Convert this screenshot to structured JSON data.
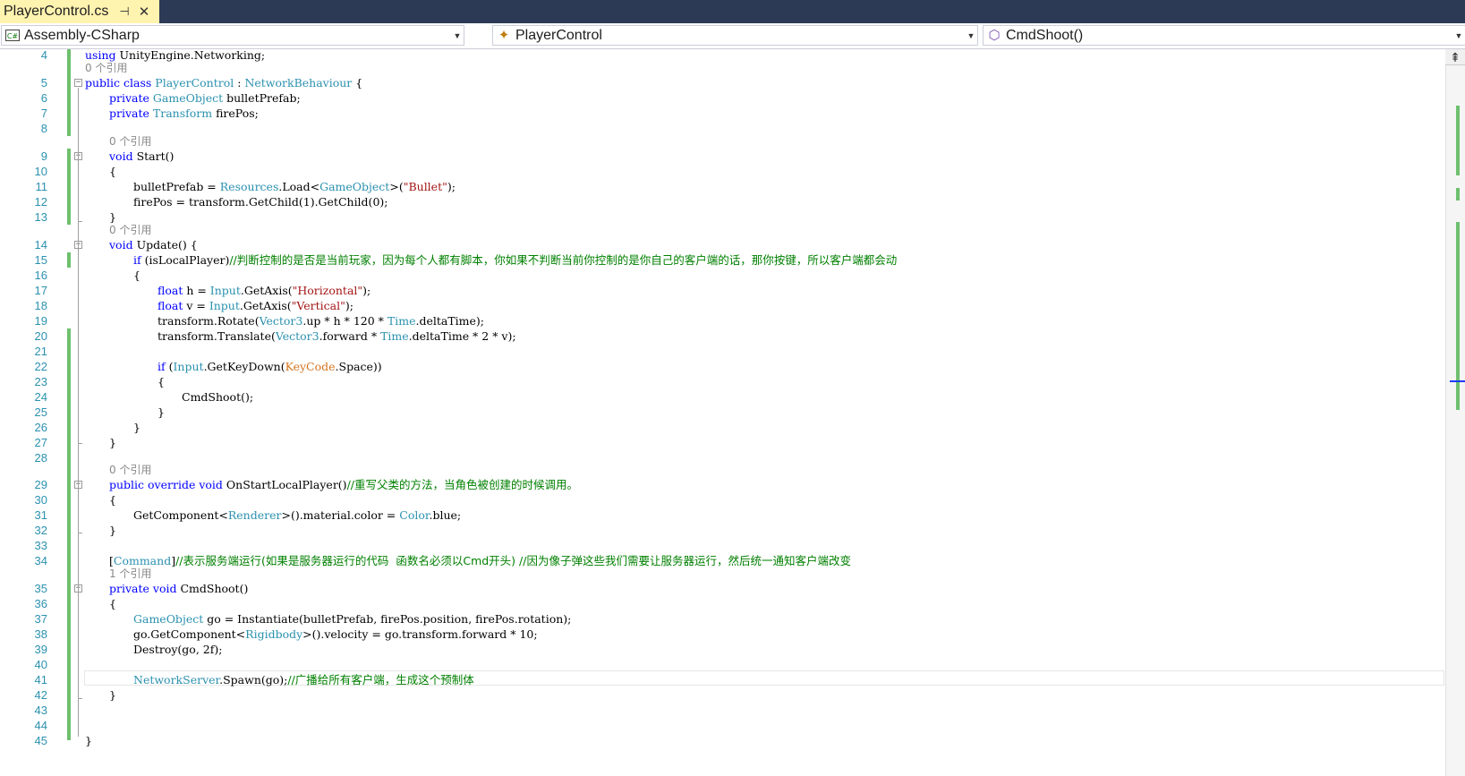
{
  "tab": {
    "title": "PlayerControl.cs",
    "pin_icon": "pin-icon",
    "close_icon": "close-icon"
  },
  "nav": {
    "project": "Assembly-CSharp",
    "class": "PlayerControl",
    "member": "CmdShoot()"
  },
  "editor": {
    "ref0": "0 个引用",
    "ref1": "1 个引用",
    "lines": {
      "l4_a": "using",
      "l4_b": " UnityEngine.Networking;",
      "l5_kw": "public class",
      "l5_type": "PlayerControl",
      "l5_sep": " : ",
      "l5_base": "NetworkBehaviour",
      "l5_end": " {",
      "l6_kw": "private",
      "l6_type": "GameObject",
      "l6_rest": " bulletPrefab;",
      "l7_kw": "private",
      "l7_type": "Transform",
      "l7_rest": " firePos;",
      "l9_kw": "void",
      "l9_rest": " Start()",
      "brace_open": "{",
      "brace_close": "}",
      "l11_a": "bulletPrefab = ",
      "l11_t1": "Resources",
      "l11_b": ".Load<",
      "l11_t2": "GameObject",
      "l11_c": ">(",
      "l11_s": "\"Bullet\"",
      "l11_d": ");",
      "l12": "firePos = transform.GetChild(1).GetChild(0);",
      "l14_kw": "void",
      "l14_rest": " Update() {",
      "l15_kw": "if",
      "l15_rest": " (isLocalPlayer)",
      "l15_cm": "//判断控制的是否是当前玩家，因为每个人都有脚本，你如果不判断当前你控制的是你自己的客户端的话，那你按键，所以客户端都会动",
      "l17_kw": "float",
      "l17_a": " h = ",
      "l17_t": "Input",
      "l17_b": ".GetAxis(",
      "l17_s": "\"Horizontal\"",
      "l17_c": ");",
      "l18_kw": "float",
      "l18_a": " v = ",
      "l18_t": "Input",
      "l18_b": ".GetAxis(",
      "l18_s": "\"Vertical\"",
      "l18_c": ");",
      "l19_a": "transform.Rotate(",
      "l19_t1": "Vector3",
      "l19_b": ".up * h * 120 * ",
      "l19_t2": "Time",
      "l19_c": ".deltaTime);",
      "l20_a": "transform.Translate(",
      "l20_t1": "Vector3",
      "l20_b": ".forward * ",
      "l20_t2": "Time",
      "l20_c": ".deltaTime * 2 * v);",
      "l22_kw": "if",
      "l22_a": " (",
      "l22_t": "Input",
      "l22_b": ".GetKeyDown(",
      "l22_e": "KeyCode",
      "l22_c": ".Space))",
      "l24": "CmdShoot();",
      "l29_kw": "public override void",
      "l29_rest": " OnStartLocalPlayer()",
      "l29_cm": "//重写父类的方法，当角色被创建的时候调用。",
      "l31_a": "GetComponent<",
      "l31_t1": "Renderer",
      "l31_b": ">().material.color = ",
      "l31_t2": "Color",
      "l31_c": ".blue;",
      "l34_a": "[",
      "l34_t": "Command",
      "l34_b": "]",
      "l34_cm": "//表示服务端运行(如果是服务器运行的代码  函数名必须以Cmd开头) //因为像子弹这些我们需要让服务器运行，然后统一通知客户端改变",
      "l35_kw": "private void",
      "l35_rest": " CmdShoot()",
      "l37_t": "GameObject",
      "l37_rest": " go = Instantiate(bulletPrefab, firePos.position, firePos.rotation);",
      "l38_a": "go.GetComponent<",
      "l38_t": "Rigidbody",
      "l38_b": ">().velocity = go.transform.forward * 10;",
      "l39": "Destroy(go, 2f);",
      "l41_t": "NetworkServer",
      "l41_a": ".Spawn(go);",
      "l41_cm": "//广播给所有客户端，生成这个预制体"
    },
    "line_numbers": [
      "4",
      "5",
      "6",
      "7",
      "8",
      "9",
      "10",
      "11",
      "12",
      "13",
      "14",
      "15",
      "16",
      "17",
      "18",
      "19",
      "20",
      "21",
      "22",
      "23",
      "24",
      "25",
      "26",
      "27",
      "28",
      "29",
      "30",
      "31",
      "32",
      "33",
      "34",
      "35",
      "36",
      "37",
      "38",
      "39",
      "40",
      "41",
      "42",
      "43",
      "44",
      "45"
    ]
  },
  "colors": {
    "keyword": "#0000ff",
    "type": "#2b91af",
    "string": "#a31515",
    "comment": "#008000",
    "enum": "#d5741f",
    "change_marker": "#6ec06e",
    "tab_active": "#fff3b0",
    "tab_strip": "#2d3a55"
  }
}
